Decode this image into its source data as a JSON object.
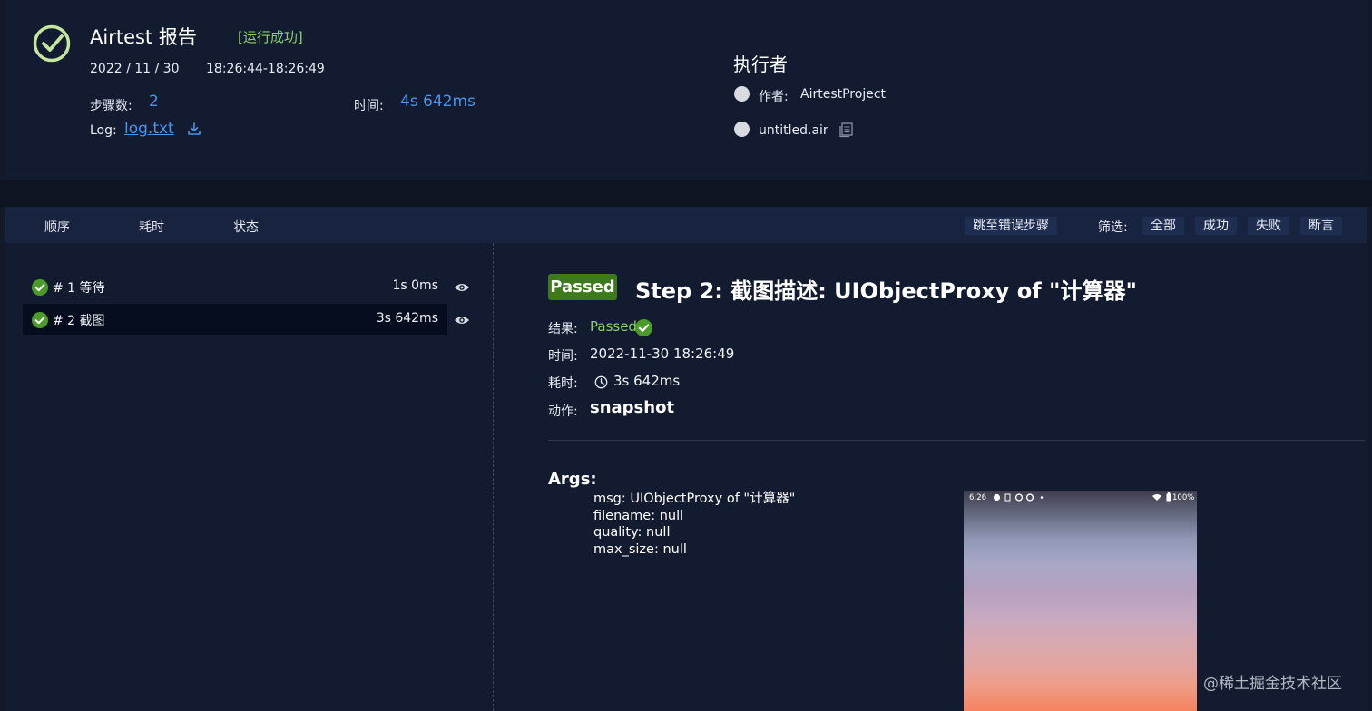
{
  "header": {
    "report_title": "Airtest 报告",
    "run_status": "[运行成功]",
    "date": "2022 / 11 / 30",
    "time_range": "18:26:44-18:26:49",
    "steps_label": "步骤数:",
    "steps_value": "2",
    "duration_label": "时间:",
    "duration_value": "4s 642ms",
    "log_label": "Log:",
    "log_link": "log.txt",
    "executor_title": "执行者",
    "author_label": "作者:",
    "author_value": "AirtestProject",
    "script_name": "untitled.air"
  },
  "toolbar": {
    "col_order": "顺序",
    "col_time": "耗时",
    "col_status": "状态",
    "jump_error": "跳至错误步骤",
    "filter_label": "筛选:",
    "filter_all": "全部",
    "filter_success": "成功",
    "filter_fail": "失败",
    "filter_assert": "断言"
  },
  "steps": [
    {
      "label": "# 1 等待",
      "duration": "1s 0ms"
    },
    {
      "label": "# 2 截图",
      "duration": "3s 642ms"
    }
  ],
  "detail": {
    "badge": "Passed",
    "title": "Step 2: 截图描述: UIObjectProxy of \"计算器\"",
    "result_label": "结果:",
    "result_value": "Passed",
    "time_label": "时间:",
    "time_value": "2022-11-30 18:26:49",
    "cost_label": "耗时:",
    "cost_value": "3s 642ms",
    "action_label": "动作:",
    "action_value": "snapshot",
    "args_title": "Args:",
    "args": [
      "msg: UIObjectProxy of \"计算器\"",
      "filename: null",
      "quality: null",
      "max_size: null"
    ]
  },
  "screenshot": {
    "clock": "6:26",
    "battery": "100%"
  },
  "watermark": "@稀土掘金技术社区",
  "colors": {
    "page_bg": "#12192b",
    "success_green": "#8bd168",
    "link_blue": "#4a95e8",
    "badge_green": "#3d7a1c"
  }
}
